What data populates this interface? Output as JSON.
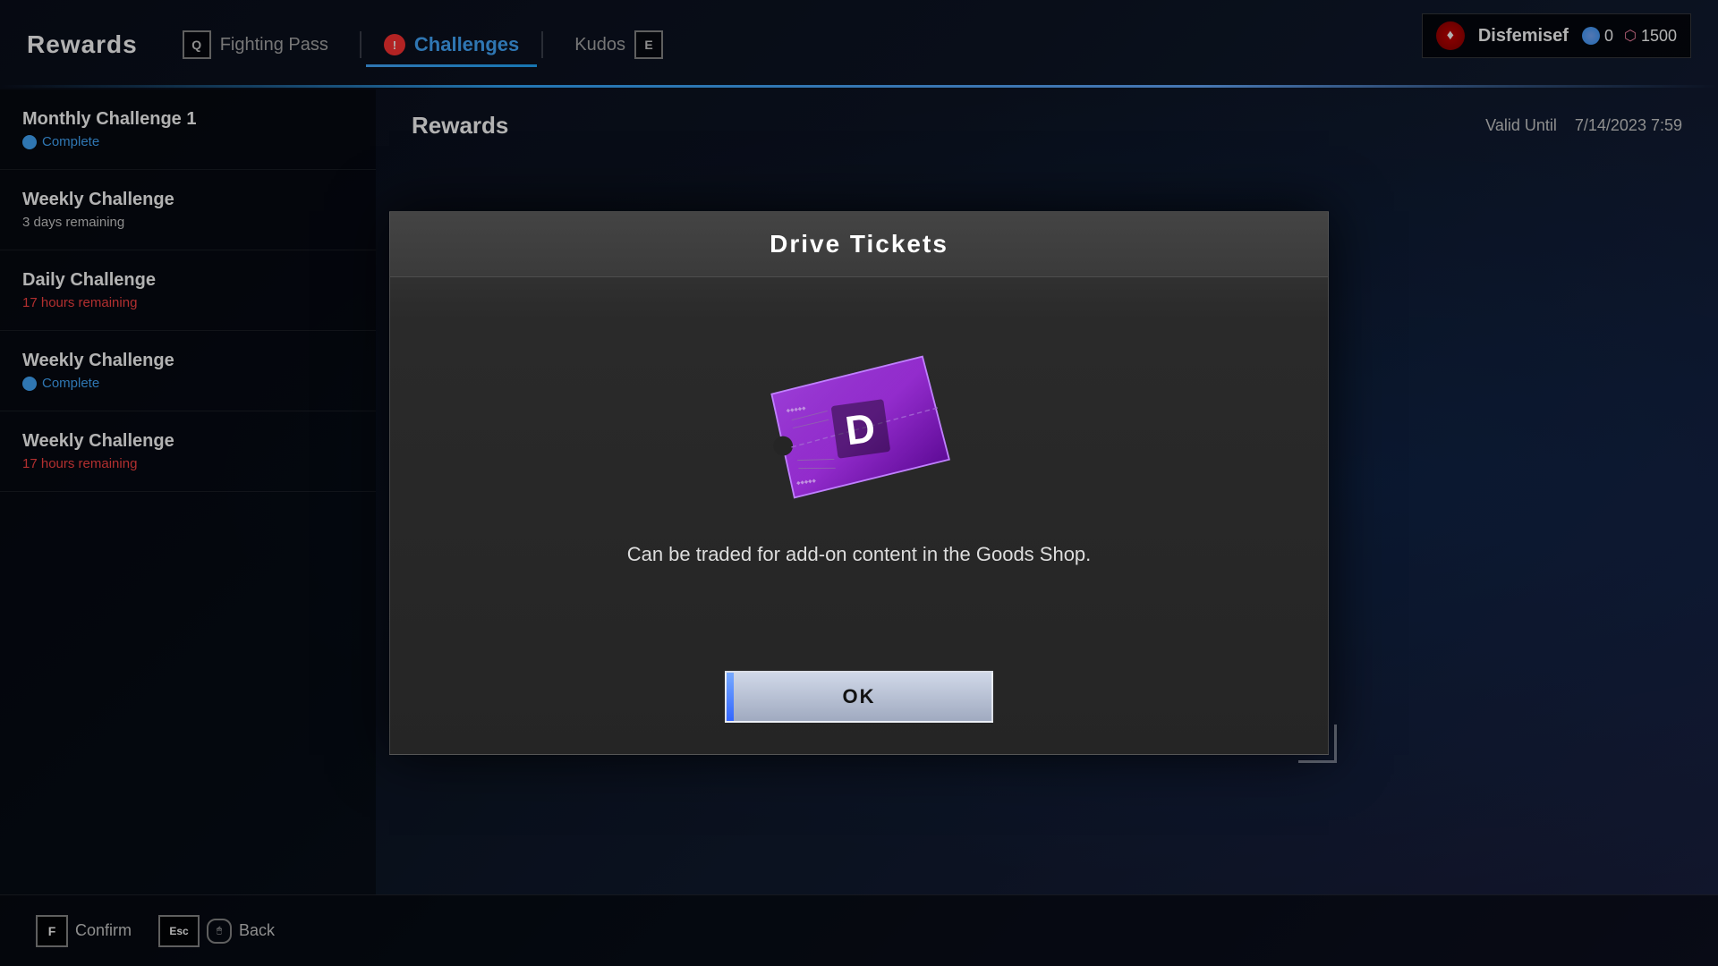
{
  "page": {
    "title": "Rewards"
  },
  "tabs": [
    {
      "id": "fighting-pass",
      "label": "Fighting Pass",
      "key": "Q",
      "active": false
    },
    {
      "id": "challenges",
      "label": "Challenges",
      "active": true,
      "has_notif": true
    },
    {
      "id": "kudos",
      "label": "Kudos",
      "key": "E",
      "active": false
    }
  ],
  "user": {
    "name": "Disfemisef",
    "drive_currency": "0",
    "fight_currency": "1500",
    "avatar_icon": "♦"
  },
  "sidebar": {
    "items": [
      {
        "title": "Monthly Challenge 1",
        "status": "Complete",
        "status_type": "complete"
      },
      {
        "title": "Weekly Challenge",
        "status": "3 days remaining",
        "status_type": "neutral"
      },
      {
        "title": "Daily Challenge",
        "status": "17 hours remaining",
        "status_type": "warning"
      },
      {
        "title": "Weekly Challenge",
        "status": "Complete",
        "status_type": "complete"
      },
      {
        "title": "Weekly Challenge",
        "status": "17 hours remaining",
        "status_type": "warning"
      }
    ]
  },
  "main": {
    "rewards_label": "Rewards",
    "valid_until_label": "Valid Until",
    "valid_until_value": "7/14/2023 7:59"
  },
  "modal": {
    "title": "Drive Tickets",
    "description": "Can be traded for add-on content in the Goods Shop.",
    "ok_label": "OK"
  },
  "bottom_bar": {
    "confirm_key": "F",
    "confirm_label": "Confirm",
    "back_key": "Esc",
    "back_label": "Back",
    "mouse_icon": "🖱"
  }
}
